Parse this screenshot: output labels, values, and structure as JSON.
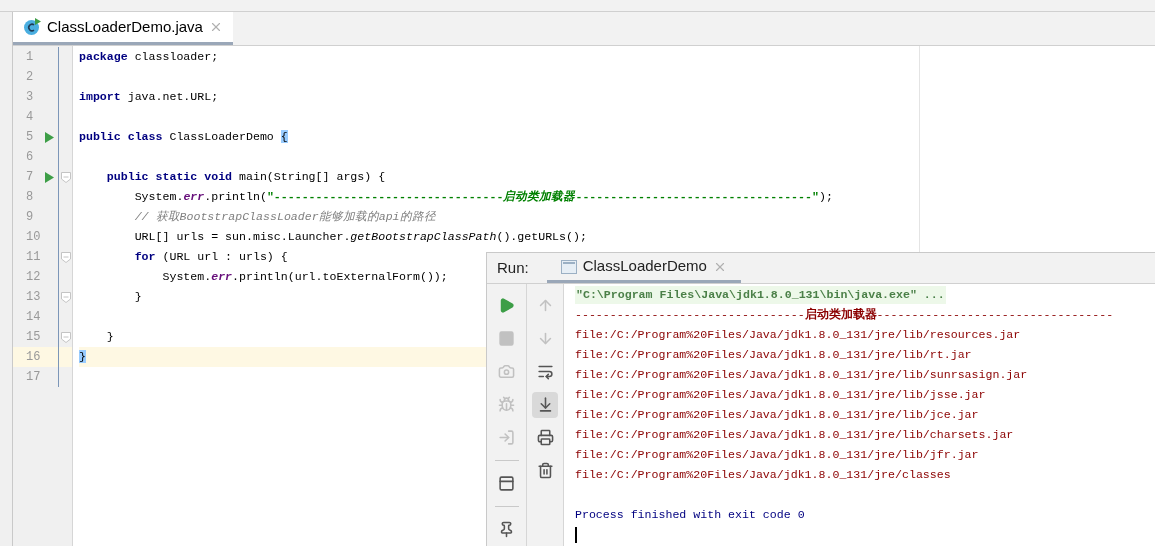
{
  "editor_tab": {
    "label": "ClassLoaderDemo.java",
    "selected": true
  },
  "code_lines": [
    {
      "number": "1",
      "run": false,
      "fold": false,
      "current": false,
      "tokens": [
        {
          "kind": "kw",
          "text": "package"
        },
        {
          "kind": "plain",
          "text": " classloader;"
        }
      ]
    },
    {
      "number": "2",
      "run": false,
      "fold": false,
      "current": false
    },
    {
      "number": "3",
      "run": false,
      "fold": false,
      "current": false,
      "tokens": [
        {
          "kind": "kw",
          "text": "import"
        },
        {
          "kind": "plain",
          "text": " java.net.URL;"
        }
      ]
    },
    {
      "number": "4",
      "run": false,
      "fold": false,
      "current": false
    },
    {
      "number": "5",
      "run": true,
      "fold": false,
      "current": false,
      "tokens": [
        {
          "kind": "kw",
          "text": "public class"
        },
        {
          "kind": "plain",
          "text": " ClassLoaderDemo "
        },
        {
          "kind": "match",
          "text": "{"
        }
      ]
    },
    {
      "number": "6",
      "run": false,
      "fold": false,
      "current": false
    },
    {
      "number": "7",
      "run": true,
      "fold": true,
      "current": false,
      "tokens": [
        {
          "kind": "kw",
          "text": "    public static void"
        },
        {
          "kind": "plain",
          "text": " main(String[] args) {"
        }
      ]
    },
    {
      "number": "8",
      "run": false,
      "fold": false,
      "current": false,
      "tokens": [
        {
          "kind": "plain",
          "text": "        System."
        },
        {
          "kind": "field",
          "text": "err"
        },
        {
          "kind": "plain",
          "text": ".println("
        },
        {
          "kind": "str",
          "text": "\"---------------------------------"
        },
        {
          "kind": "strcn",
          "text": "启动类加载器"
        },
        {
          "kind": "str",
          "text": "----------------------------------\""
        },
        {
          "kind": "plain",
          "text": ");"
        }
      ]
    },
    {
      "number": "9",
      "run": false,
      "fold": false,
      "current": false,
      "tokens": [
        {
          "kind": "comment",
          "text": "        // 获取BootstrapClassLoader能够加载的api的路径"
        }
      ]
    },
    {
      "number": "10",
      "run": false,
      "fold": false,
      "current": false,
      "tokens": [
        {
          "kind": "plain",
          "text": "        URL[] urls = sun.misc.Launcher."
        },
        {
          "kind": "static",
          "text": "getBootstrapClassPath"
        },
        {
          "kind": "plain",
          "text": "().getURLs();"
        }
      ]
    },
    {
      "number": "11",
      "run": false,
      "fold": true,
      "current": false,
      "tokens": [
        {
          "kind": "kw",
          "text": "        for"
        },
        {
          "kind": "plain",
          "text": " (URL url : urls) {"
        }
      ]
    },
    {
      "number": "12",
      "run": false,
      "fold": false,
      "current": false,
      "tokens": [
        {
          "kind": "plain",
          "text": "            System."
        },
        {
          "kind": "field",
          "text": "err"
        },
        {
          "kind": "plain",
          "text": ".println(url.toExternalForm());"
        }
      ]
    },
    {
      "number": "13",
      "run": false,
      "fold": true,
      "current": false,
      "tokens": [
        {
          "kind": "plain",
          "text": "        }"
        }
      ]
    },
    {
      "number": "14",
      "run": false,
      "fold": false,
      "current": false
    },
    {
      "number": "15",
      "run": false,
      "fold": true,
      "current": false,
      "tokens": [
        {
          "kind": "plain",
          "text": "    }"
        }
      ]
    },
    {
      "number": "16",
      "run": false,
      "fold": false,
      "current": true,
      "tokens": [
        {
          "kind": "match",
          "text": "}"
        }
      ]
    },
    {
      "number": "17",
      "run": false,
      "fold": false,
      "current": false
    }
  ],
  "run_panel": {
    "title": "Run:",
    "tab": {
      "label": "ClassLoaderDemo",
      "selected": true
    },
    "toolbar_left": [
      {
        "kind": "play",
        "disabled": false
      },
      {
        "kind": "stop",
        "disabled": true
      },
      {
        "kind": "camera",
        "disabled": true
      },
      {
        "kind": "bug",
        "disabled": true
      },
      {
        "kind": "login",
        "disabled": true
      },
      {
        "kind": "divider"
      },
      {
        "kind": "layout",
        "disabled": false
      },
      {
        "kind": "divider"
      },
      {
        "kind": "pin",
        "disabled": false
      }
    ],
    "toolbar_right": [
      {
        "kind": "up",
        "disabled": true,
        "selected": false
      },
      {
        "kind": "down",
        "disabled": true,
        "selected": false
      },
      {
        "kind": "wrap",
        "disabled": false,
        "selected": false
      },
      {
        "kind": "scroll",
        "disabled": false,
        "selected": true
      },
      {
        "kind": "print",
        "disabled": false,
        "selected": false
      },
      {
        "kind": "trash",
        "disabled": false,
        "selected": false
      }
    ],
    "console": [
      {
        "kind": "command",
        "text": "\"C:\\Program Files\\Java\\jdk1.8.0_131\\bin\\java.exe\" ..."
      },
      {
        "kind": "stderr",
        "text": "---------------------------------**启动类加载器**----------------------------------"
      },
      {
        "kind": "stderr",
        "text": "file:/C:/Program%20Files/Java/jdk1.8.0_131/jre/lib/resources.jar"
      },
      {
        "kind": "stderr",
        "text": "file:/C:/Program%20Files/Java/jdk1.8.0_131/jre/lib/rt.jar"
      },
      {
        "kind": "stderr",
        "text": "file:/C:/Program%20Files/Java/jdk1.8.0_131/jre/lib/sunrsasign.jar"
      },
      {
        "kind": "stderr",
        "text": "file:/C:/Program%20Files/Java/jdk1.8.0_131/jre/lib/jsse.jar"
      },
      {
        "kind": "stderr",
        "text": "file:/C:/Program%20Files/Java/jdk1.8.0_131/jre/lib/jce.jar"
      },
      {
        "kind": "stderr",
        "text": "file:/C:/Program%20Files/Java/jdk1.8.0_131/jre/lib/charsets.jar"
      },
      {
        "kind": "stderr",
        "text": "file:/C:/Program%20Files/Java/jdk1.8.0_131/jre/lib/jfr.jar"
      },
      {
        "kind": "stderr",
        "text": "file:/C:/Program%20Files/Java/jdk1.8.0_131/jre/classes"
      },
      {
        "kind": "blank"
      },
      {
        "kind": "info",
        "text": "Process finished with exit code 0"
      },
      {
        "kind": "cursor"
      }
    ]
  }
}
